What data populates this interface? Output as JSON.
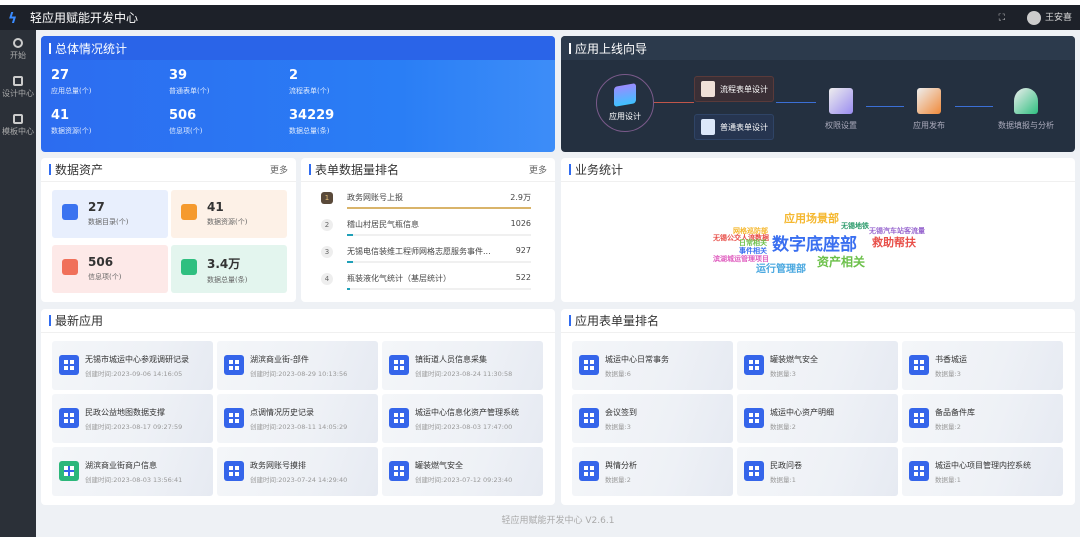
{
  "app": {
    "title": "轻应用赋能开发中心",
    "user": "王安喜",
    "fullscreen_icon": "fullscreen-icon"
  },
  "sidebar": {
    "items": [
      {
        "label": "开始",
        "icon": "dashboard-icon"
      },
      {
        "label": "设计中心",
        "icon": "design-icon"
      },
      {
        "label": "模板中心",
        "icon": "template-icon"
      }
    ]
  },
  "overview": {
    "title": "总体情况统计",
    "stats": [
      {
        "value": "27",
        "label": "应用总量(个)"
      },
      {
        "value": "39",
        "label": "普通表单(个)"
      },
      {
        "value": "2",
        "label": "流程表单(个)"
      },
      {
        "value": "41",
        "label": "数据资源(个)"
      },
      {
        "value": "506",
        "label": "信息项(个)"
      },
      {
        "value": "34229",
        "label": "数据总量(条)"
      }
    ]
  },
  "guide": {
    "title": "应用上线向导",
    "center": "应用设计",
    "flow_form": "流程表单设计",
    "normal_form": "普通表单设计",
    "steps": [
      "权限设置",
      "应用发布",
      "数据填报与分析"
    ]
  },
  "assets": {
    "title": "数据资产",
    "more": "更多",
    "tiles": [
      {
        "value": "27",
        "label": "数据目录(个)",
        "color": "#e8effd",
        "icon": "#3a73f0"
      },
      {
        "value": "41",
        "label": "数据资源(个)",
        "color": "#fdf1e7",
        "icon": "#f59a2e"
      },
      {
        "value": "506",
        "label": "信息项(个)",
        "color": "#fde9e8",
        "icon": "#f0705a"
      },
      {
        "value": "3.4万",
        "label": "数据总量(条)",
        "color": "#e3f5ee",
        "icon": "#2fbf80"
      }
    ]
  },
  "ranking": {
    "title": "表单数据量排名",
    "more": "更多",
    "items": [
      {
        "rank": "1",
        "name": "政务网账号上报",
        "value": "2.9万",
        "pct": 100
      },
      {
        "rank": "2",
        "name": "稽山村居民气瓶信息",
        "value": "1026",
        "pct": 3.5
      },
      {
        "rank": "3",
        "name": "无锡电信装维工程师网格志愿服务事件...",
        "value": "927",
        "pct": 3.2
      },
      {
        "rank": "4",
        "name": "瓶装液化气统计（基层统计）",
        "value": "522",
        "pct": 1.8
      }
    ]
  },
  "business": {
    "title": "业务统计",
    "words": [
      {
        "text": "数字底座部",
        "color": "#3a6ff0"
      },
      {
        "text": "应用场景部",
        "color": "#f5b830"
      },
      {
        "text": "救助帮扶",
        "color": "#e8504a"
      },
      {
        "text": "资产相关",
        "color": "#6cc04a"
      },
      {
        "text": "运行管理部",
        "color": "#4aa8e0"
      },
      {
        "text": "无锡地铁",
        "color": "#2a9a6a"
      },
      {
        "text": "无锡汽车站客流量",
        "color": "#9a6ad0"
      },
      {
        "text": "网格巡防部",
        "color": "#f5b830"
      },
      {
        "text": "无锡公交人流数据",
        "color": "#e8504a"
      },
      {
        "text": "日常相关",
        "color": "#6cc04a"
      },
      {
        "text": "事件相关",
        "color": "#3a6ff0"
      },
      {
        "text": "滨湖城运管理项目",
        "color": "#e060c0"
      }
    ]
  },
  "latest": {
    "title": "最新应用",
    "items": [
      {
        "name": "无锡市城运中心参观调研记录",
        "time": "创建时间:2023-09-06 14:16:05"
      },
      {
        "name": "湖滨商业街-部件",
        "time": "创建时间:2023-08-29 10:13:56"
      },
      {
        "name": "镇街道人员信息采集",
        "time": "创建时间:2023-08-24 11:30:58"
      },
      {
        "name": "民政公益地图数据支撑",
        "time": "创建时间:2023-08-17 09:27:59"
      },
      {
        "name": "点调情况历史记录",
        "time": "创建时间:2023-08-11 14:05:29"
      },
      {
        "name": "城运中心信息化资产管理系统",
        "time": "创建时间:2023-08-03 17:47:00"
      },
      {
        "name": "湖滨商业街商户信息",
        "time": "创建时间:2023-08-03 13:56:41"
      },
      {
        "name": "政务网账号摸排",
        "time": "创建时间:2023-07-24 14:29:40"
      },
      {
        "name": "罐装燃气安全",
        "time": "创建时间:2023-07-12 09:23:40"
      }
    ]
  },
  "form_rank": {
    "title": "应用表单量排名",
    "items": [
      {
        "name": "城运中心日常事务",
        "count": "数据量:6"
      },
      {
        "name": "罐装燃气安全",
        "count": "数据量:3"
      },
      {
        "name": "书香城运",
        "count": "数据量:3"
      },
      {
        "name": "会议签到",
        "count": "数据量:3"
      },
      {
        "name": "城运中心资产明细",
        "count": "数据量:2"
      },
      {
        "name": "备品备件库",
        "count": "数据量:2"
      },
      {
        "name": "舆情分析",
        "count": "数据量:2"
      },
      {
        "name": "民政问卷",
        "count": "数据量:1"
      },
      {
        "name": "城运中心项目管理内控系统",
        "count": "数据量:1"
      }
    ]
  },
  "footer": {
    "text": "轻应用赋能开发中心 V2.6.1"
  }
}
